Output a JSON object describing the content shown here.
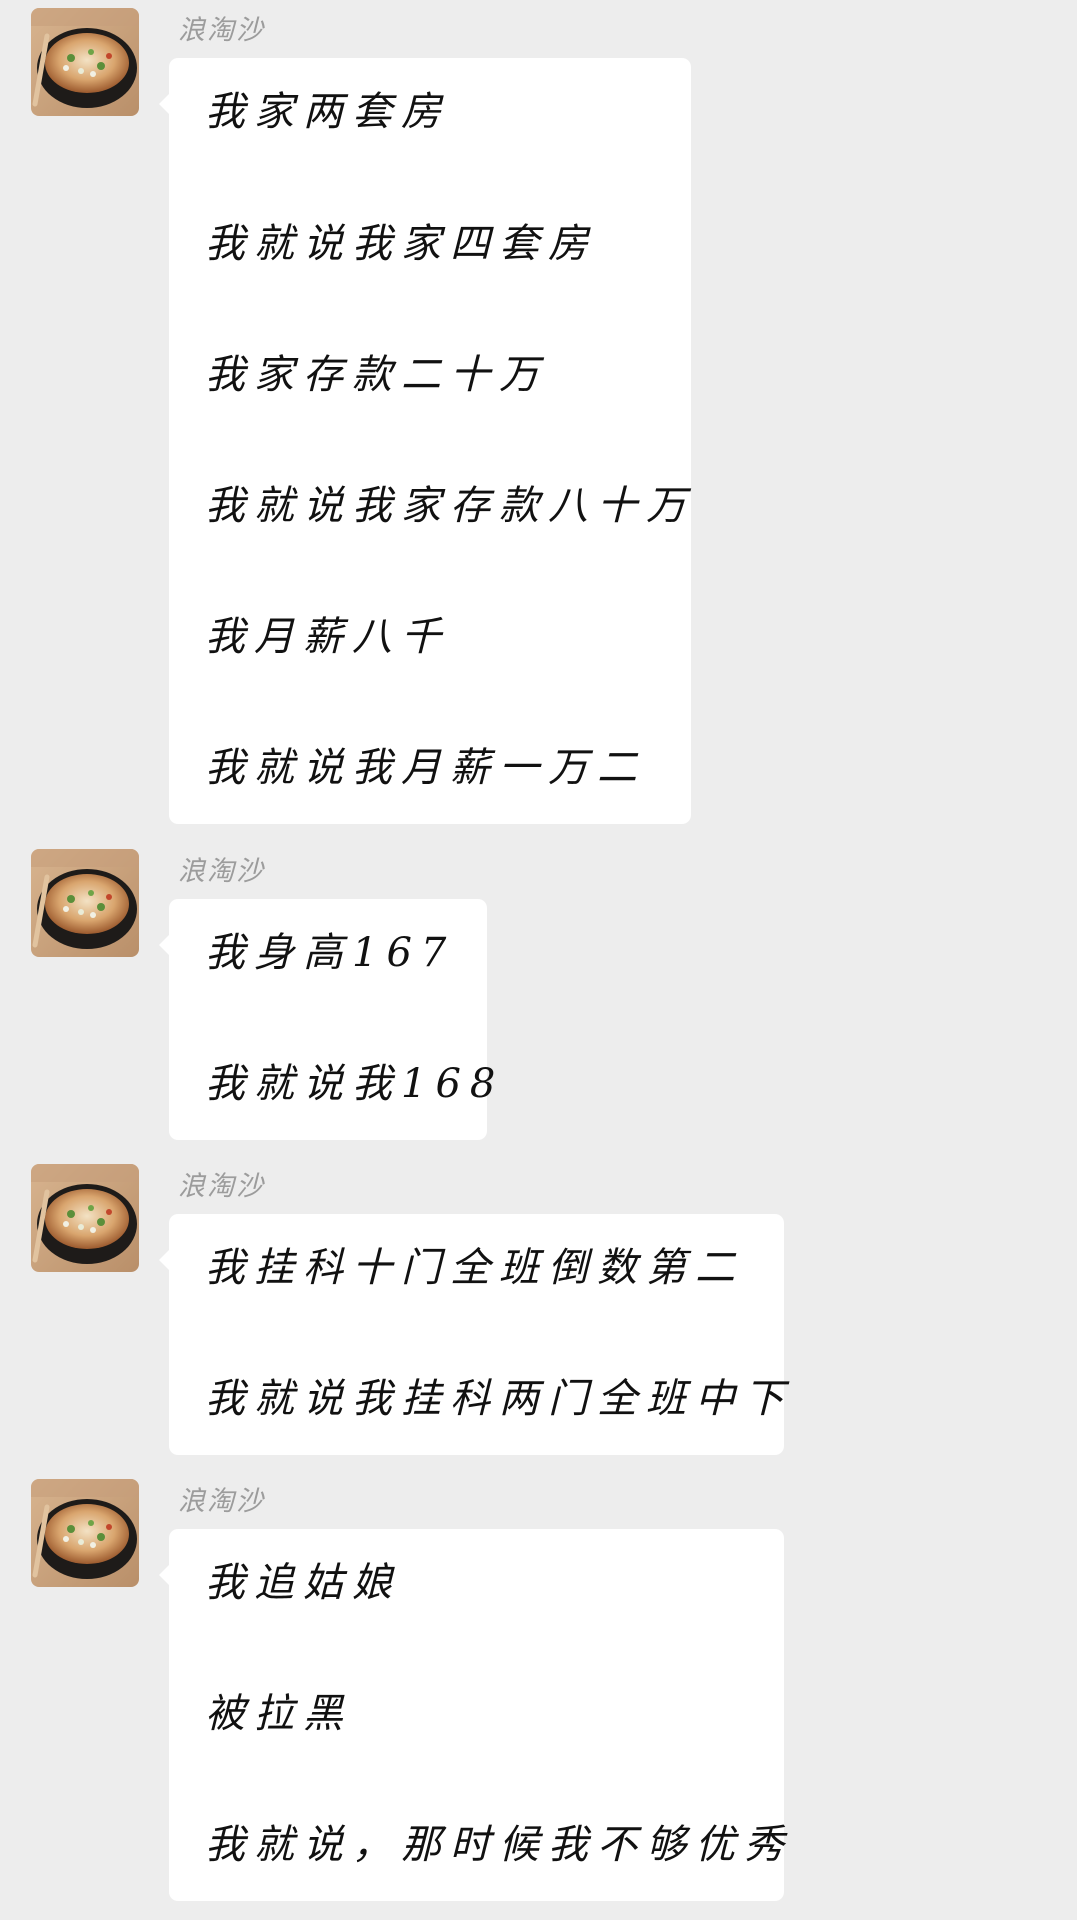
{
  "chat": {
    "messages": [
      {
        "sender": "浪淘沙",
        "lines": [
          "我家两套房",
          "我就说我家四套房",
          "我家存款二十万",
          "我就说我家存款八十万",
          "我月薪八千",
          "我就说我月薪一万二"
        ]
      },
      {
        "sender": "浪淘沙",
        "lines": [
          "我身高167",
          "我就说我168"
        ]
      },
      {
        "sender": "浪淘沙",
        "lines": [
          "我挂科十门全班倒数第二",
          "我就说我挂科两门全班中下"
        ]
      },
      {
        "sender": "浪淘沙",
        "lines": [
          "我追姑娘",
          "被拉黑",
          "我就说，那时候我不够优秀"
        ]
      }
    ]
  }
}
